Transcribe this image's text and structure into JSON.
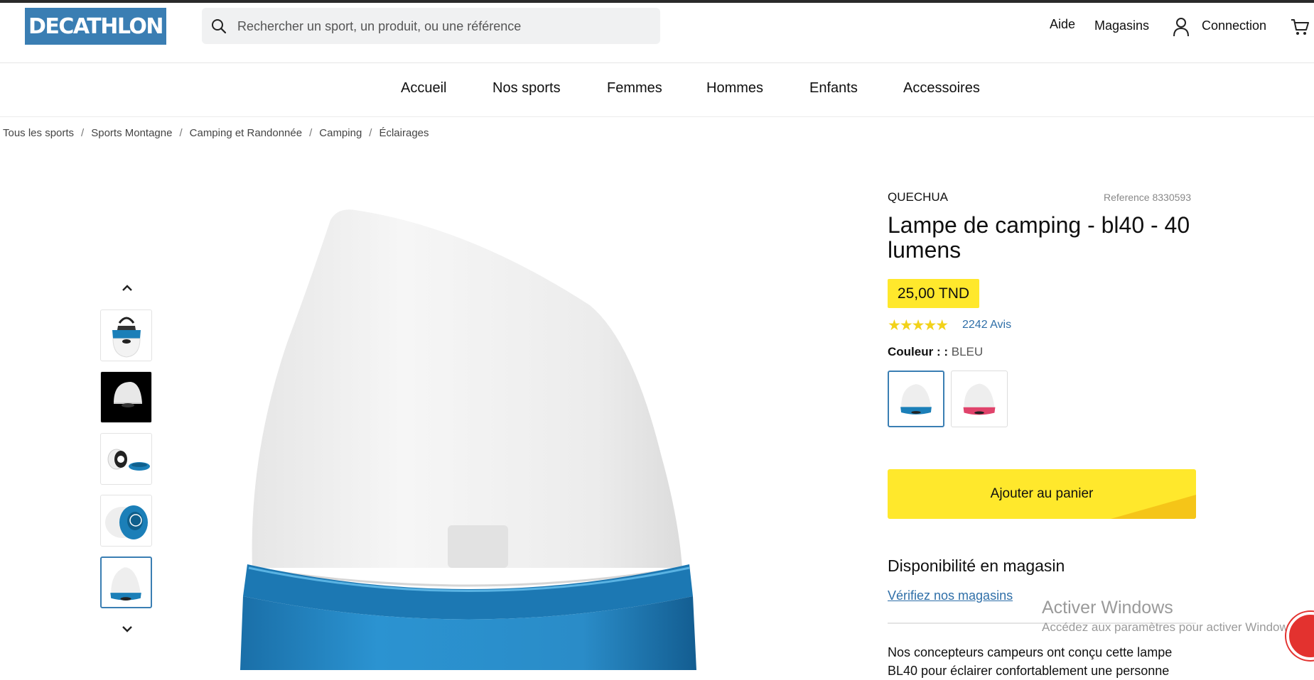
{
  "header": {
    "logo_text": "DECATHLON",
    "search_placeholder": "Rechercher un sport, un produit, ou une référence",
    "links": {
      "aide": "Aide",
      "magasins": "Magasins",
      "connection": "Connection"
    }
  },
  "nav": {
    "items": [
      {
        "label": "Accueil"
      },
      {
        "label": "Nos sports"
      },
      {
        "label": "Femmes"
      },
      {
        "label": "Hommes"
      },
      {
        "label": "Enfants"
      },
      {
        "label": "Accessoires"
      }
    ]
  },
  "breadcrumb": {
    "items": [
      "Tous les sports",
      "Sports Montagne",
      "Camping et Randonnée",
      "Camping",
      "Éclairages"
    ],
    "separator": "/"
  },
  "gallery": {
    "thumbnails": [
      "lamp-top-hanging",
      "lamp-lit-dark",
      "lamp-open-parts",
      "lamp-bottom-view",
      "lamp-front"
    ],
    "active_index": 4
  },
  "product": {
    "brand": "QUECHUA",
    "reference": "Reference 8330593",
    "title": "Lampe de camping - bl40 - 40 lumens",
    "price": "25,00 TND",
    "rating_stars": "★★★★★",
    "rating": 4.5,
    "reviews": "2242 Avis",
    "color_label": "Couleur : :",
    "color_value": "BLEU",
    "swatches": [
      {
        "color": "#1b7fb8",
        "selected": true
      },
      {
        "color": "#e0436b",
        "selected": false
      }
    ],
    "add_to_cart": "Ajouter au panier",
    "availability_title": "Disponibilité en magasin",
    "check_stores": "Vérifiez nos magasins",
    "description": "Nos concepteurs campeurs ont conçu cette lampe BL40 pour éclairer confortablement une personne"
  },
  "overlay": {
    "windows_title": "Activer Windows",
    "windows_subtitle": "Accédez aux paramètres pour activer Windows."
  },
  "colors": {
    "brand_blue": "#3a7eb3",
    "accent_yellow": "#ffe82c",
    "link_blue": "#2f6fa8",
    "star_yellow": "#f2d21a"
  }
}
